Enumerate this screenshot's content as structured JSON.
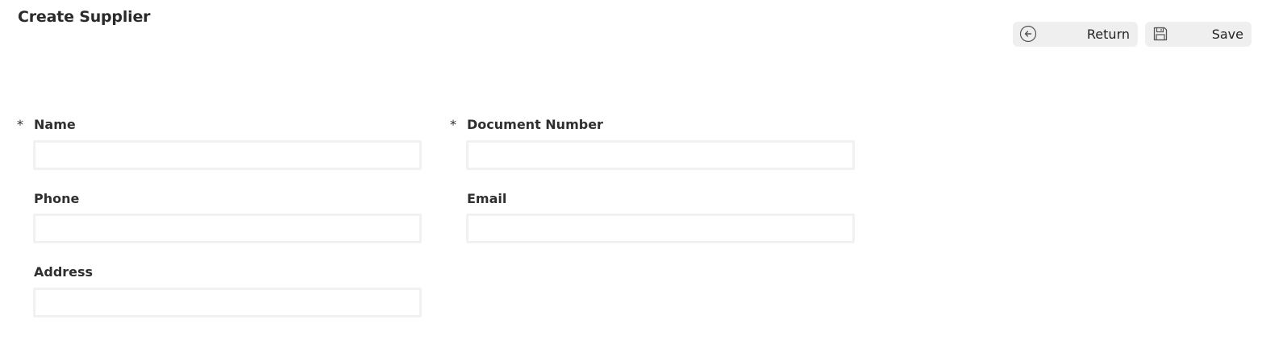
{
  "header": {
    "title": "Create Supplier"
  },
  "toolbar": {
    "return_label": "Return",
    "return_icon": "arrow-left-circle-icon",
    "save_label": "Save",
    "save_icon": "floppy-disk-icon"
  },
  "form": {
    "required_marker": "*",
    "fields": {
      "name": {
        "label": "Name",
        "value": "",
        "required": true
      },
      "document_number": {
        "label": "Document Number",
        "value": "",
        "required": true
      },
      "phone": {
        "label": "Phone",
        "value": "",
        "required": false
      },
      "email": {
        "label": "Email",
        "value": "",
        "required": false
      },
      "address": {
        "label": "Address",
        "value": "",
        "required": false
      }
    }
  },
  "colors": {
    "button_bg": "#efefef",
    "input_border": "#f1f1f1",
    "text": "#2b2b2b"
  }
}
